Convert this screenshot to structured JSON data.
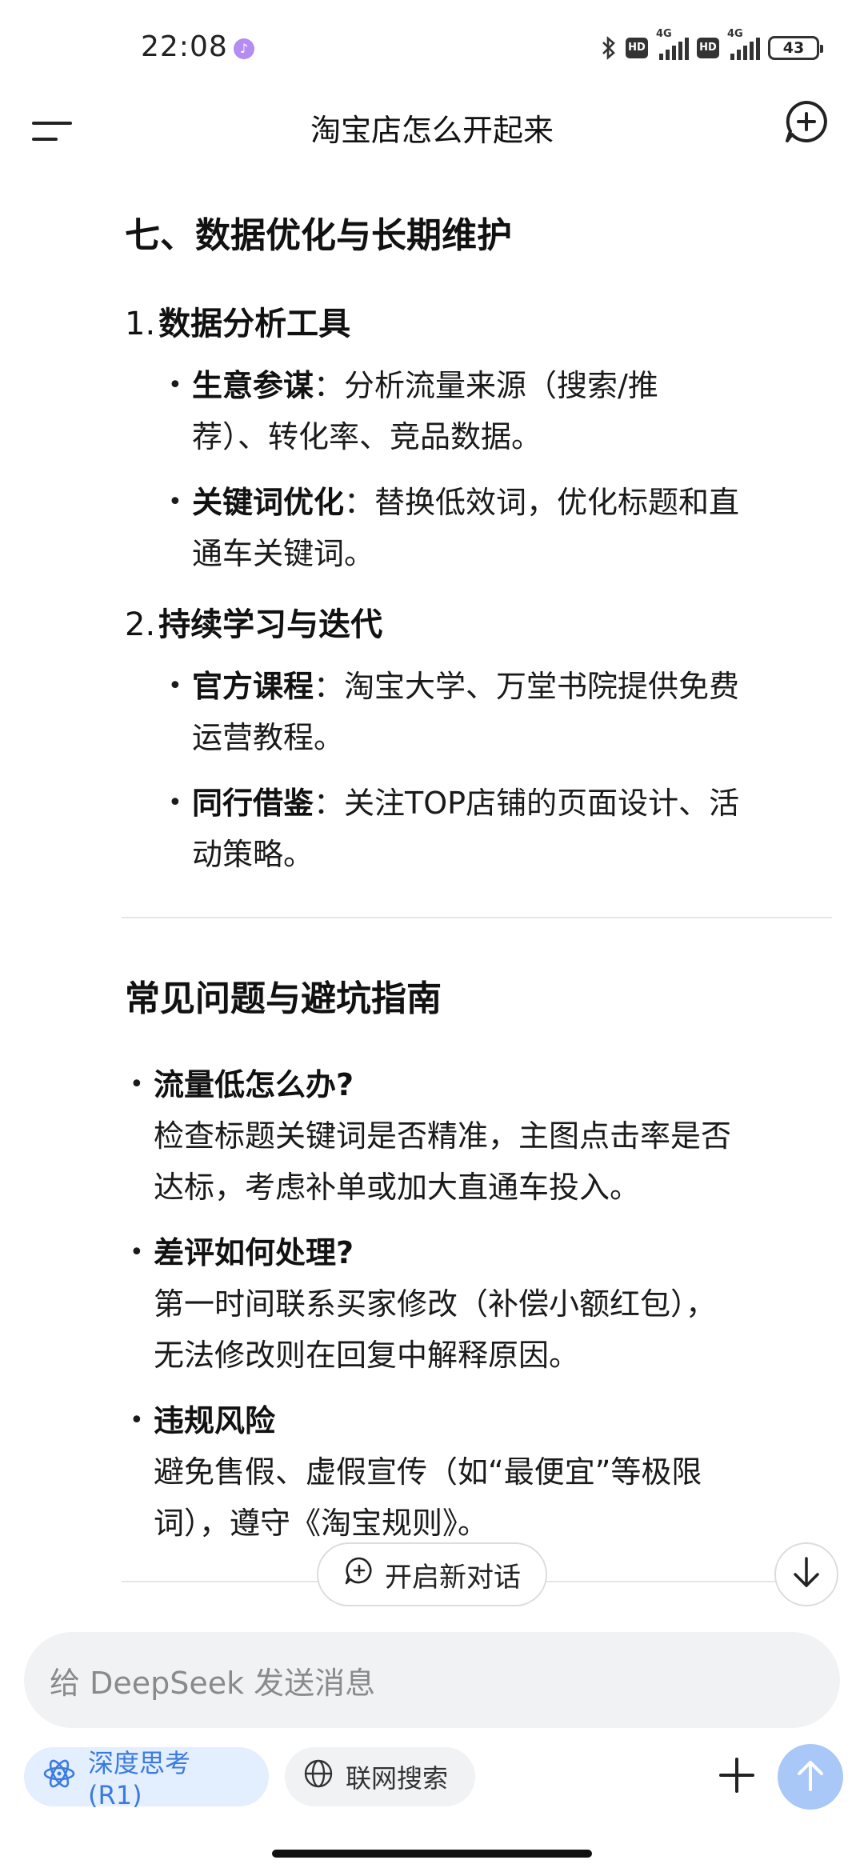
{
  "status_bar": {
    "time": "22:08",
    "app_notification_icon": "tiktok-icon",
    "hd1": "HD",
    "net1": "4G",
    "hd2": "HD",
    "net2": "4G",
    "battery": "43"
  },
  "header": {
    "title": "淘宝店怎么开起来",
    "menu_icon": "menu-icon",
    "new_chat_icon": "new-chat-icon"
  },
  "content": {
    "section7": {
      "heading": "七、数据优化与长期维护",
      "items": [
        {
          "num": "1.",
          "title": "数据分析工具",
          "bullets": [
            {
              "label": "生意参谋",
              "sep": "：",
              "line1": "分析流量来源（搜索/推",
              "line2": "荐）、转化率、竞品数据。"
            },
            {
              "label": "关键词优化",
              "sep": "：",
              "line1": "替换低效词，优化标题和直",
              "line2": "通车关键词。"
            }
          ]
        },
        {
          "num": "2.",
          "title": "持续学习与迭代",
          "bullets": [
            {
              "label": "官方课程",
              "sep": "：",
              "line1": "淘宝大学、万堂书院提供免费",
              "line2": "运营教程。"
            },
            {
              "label": "同行借鉴",
              "sep": "：",
              "line1": "关注TOP店铺的页面设计、活",
              "line2": "动策略。"
            }
          ]
        }
      ]
    },
    "faq": {
      "heading": "常见问题与避坑指南",
      "items": [
        {
          "title": "流量低怎么办?",
          "line1": "检查标题关键词是否精准，主图点击率是否",
          "line2": "达标，考虑补单或加大直通车投入。"
        },
        {
          "title": "差评如何处理?",
          "line1": "第一时间联系买家修改（补偿小额红包），",
          "line2": "无法修改则在回复中解释原因。"
        },
        {
          "title": "违规风险",
          "line1": "避免售假、虚假宣传（如“最便宜”等极限",
          "line2": "词），遵守《淘宝规则》。"
        }
      ]
    }
  },
  "floating": {
    "new_dialog_label": "开启新对话"
  },
  "composer": {
    "placeholder": "给 DeepSeek 发送消息",
    "deep_think_label": "深度思考 (R1)",
    "web_search_label": "联网搜索"
  },
  "colors": {
    "accent_blue": "#3b7be0",
    "chip_blue_bg": "#e3eefe",
    "send_button": "#a9c8f7"
  }
}
